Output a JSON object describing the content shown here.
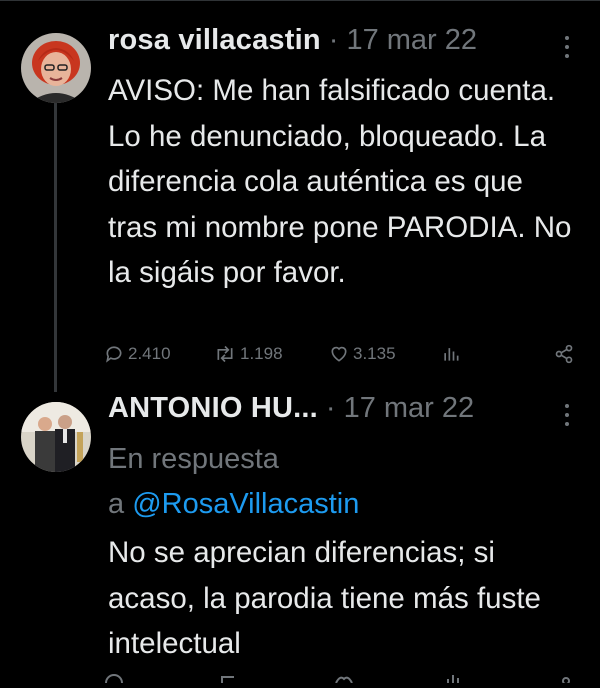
{
  "tweets": [
    {
      "author": "rosa villacastin",
      "separator": "·",
      "date": "17 mar 22",
      "text": "AVISO: Me han falsificado cuenta. Lo he denunciado, bloqueado. La diferencia cola auténtica es que tras mi nombre pone PARODIA. No la sigáis por favor.",
      "avatar": "avatar-red-hair",
      "actions": {
        "replies": "2.410",
        "retweets": "1.198",
        "likes": "3.135"
      }
    },
    {
      "author": "ANTONIO HU...",
      "separator": "·",
      "date": "17 mar 22",
      "reply_prefix": "En respuesta",
      "reply_a": "a",
      "reply_mention": "@RosaVillacastin",
      "text": "No se aprecian diferencias; si acaso, la parodia tiene más fuste intelectual",
      "avatar": "avatar-two-men"
    }
  ],
  "colors": {
    "background": "#000000",
    "text": "#e7e9ea",
    "muted": "#71767b",
    "mention": "#1d9bf0"
  }
}
